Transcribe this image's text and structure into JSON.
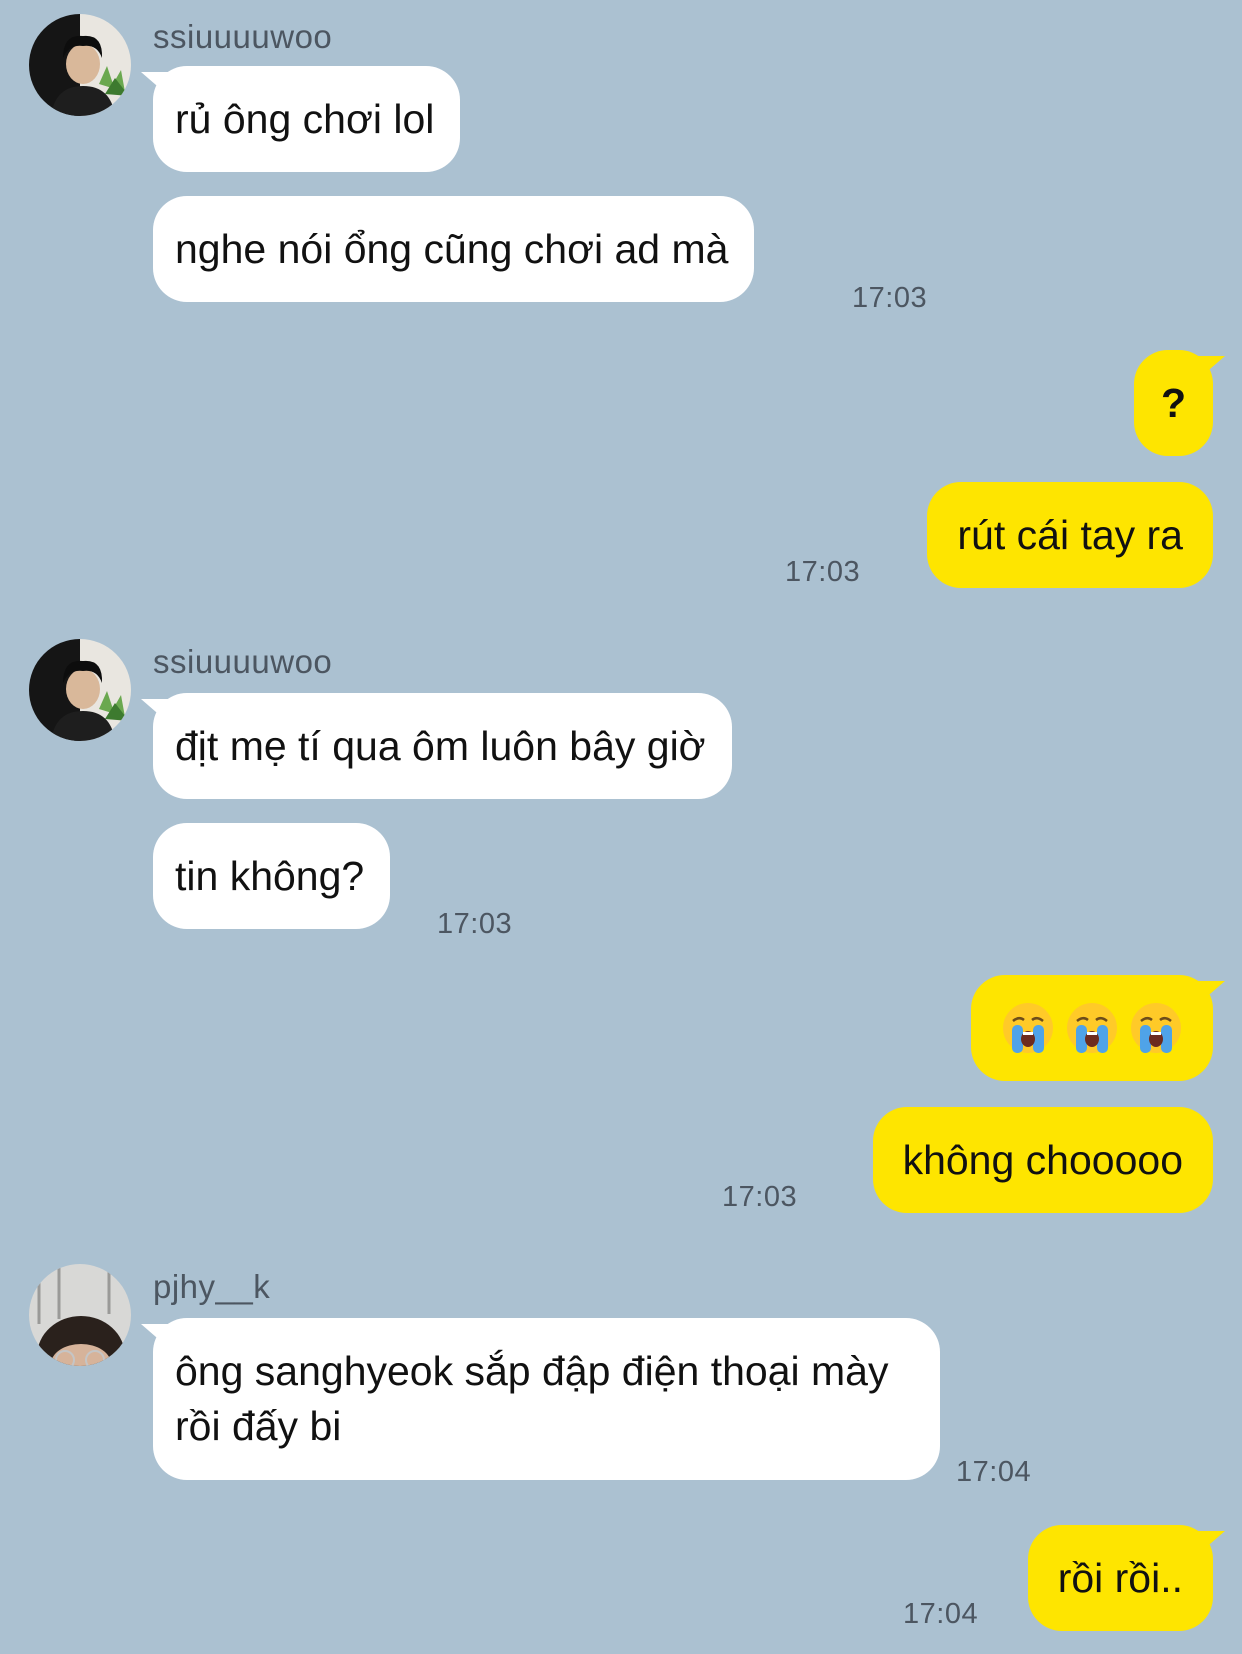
{
  "messages": [
    {
      "type": "sender",
      "name": "ssiuuuuwoo"
    },
    {
      "type": "in",
      "text": "rủ ông chơi lol"
    },
    {
      "type": "in",
      "text": "nghe nói ổng cũng chơi ad mà",
      "time": "17:03"
    },
    {
      "type": "out",
      "text": "?"
    },
    {
      "type": "out",
      "text": "rút cái tay ra",
      "time": "17:03"
    },
    {
      "type": "sender",
      "name": "ssiuuuuwoo"
    },
    {
      "type": "in",
      "text": "địt mẹ tí qua ôm luôn bây giờ"
    },
    {
      "type": "in",
      "text": "tin không?",
      "time": "17:03"
    },
    {
      "type": "out",
      "emoji": [
        "crying-face-icon",
        "crying-face-icon",
        "crying-face-icon"
      ]
    },
    {
      "type": "out",
      "text": "không chooooo",
      "time": "17:03"
    },
    {
      "type": "sender",
      "name": "pjhy__k"
    },
    {
      "type": "in",
      "text": "ông sanghyeok sắp đập điện thoại mày rồi đấy bi",
      "time": "17:04"
    },
    {
      "type": "out",
      "text": "rồi rồi..",
      "time": "17:04"
    }
  ],
  "colors": {
    "background": "#abc1d1",
    "incoming_bubble": "#ffffff",
    "outgoing_bubble": "#fee500",
    "meta_text": "#4c5661"
  }
}
